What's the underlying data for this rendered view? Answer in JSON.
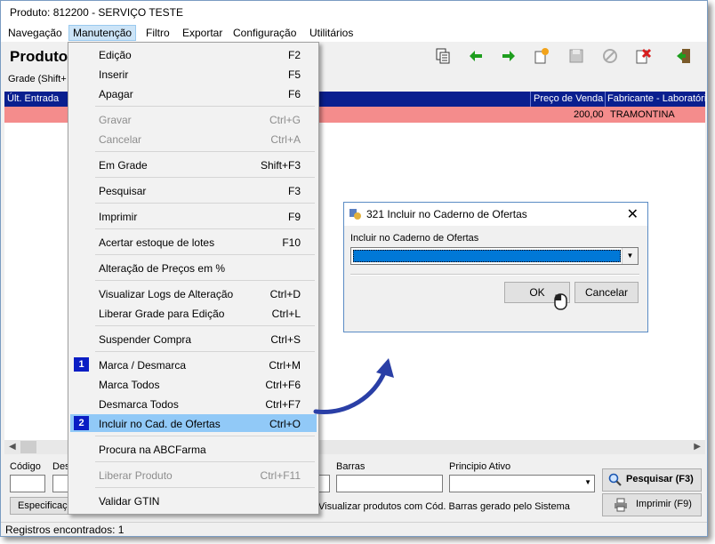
{
  "window": {
    "title": "Produto: 812200 - SERVIÇO TESTE"
  },
  "menubar": {
    "items": [
      "Navegação",
      "Manutenção",
      "Filtro",
      "Exportar",
      "Configuração",
      "Utilitários"
    ]
  },
  "page": {
    "title": "Produtos",
    "subbar": "Grade (Shift+"
  },
  "grid": {
    "columns": [
      "Últ. Entrada",
      "Preço de Venda",
      "Fabricante - Laboratório"
    ],
    "row": {
      "preco": "200,00",
      "fabricante": "TRAMONTINA"
    }
  },
  "menu": {
    "items": [
      {
        "label": "Edição",
        "shortcut": "F2"
      },
      {
        "label": "Inserir",
        "shortcut": "F5"
      },
      {
        "label": "Apagar",
        "shortcut": "F6"
      },
      {
        "label": "Gravar",
        "shortcut": "Ctrl+G"
      },
      {
        "label": "Cancelar",
        "shortcut": "Ctrl+A"
      },
      {
        "label": "Em Grade",
        "shortcut": "Shift+F3"
      },
      {
        "label": "Pesquisar",
        "shortcut": "F3"
      },
      {
        "label": "Imprimir",
        "shortcut": "F9"
      },
      {
        "label": "Acertar estoque de lotes",
        "shortcut": "F10"
      },
      {
        "label": "Alteração de Preços em %",
        "shortcut": ""
      },
      {
        "label": "Visualizar Logs de Alteração",
        "shortcut": "Ctrl+D"
      },
      {
        "label": "Liberar Grade para Edição",
        "shortcut": "Ctrl+L"
      },
      {
        "label": "Suspender Compra",
        "shortcut": "Ctrl+S"
      },
      {
        "label": "Marca / Desmarca",
        "shortcut": "Ctrl+M",
        "badge": "1"
      },
      {
        "label": "Marca Todos",
        "shortcut": "Ctrl+F6"
      },
      {
        "label": "Desmarca Todos",
        "shortcut": "Ctrl+F7"
      },
      {
        "label": "Incluir no Cad. de Ofertas",
        "shortcut": "Ctrl+O",
        "badge": "2"
      },
      {
        "label": "Procura na ABCFarma",
        "shortcut": ""
      },
      {
        "label": "Liberar Produto",
        "shortcut": "Ctrl+F11"
      },
      {
        "label": "Validar GTIN",
        "shortcut": ""
      }
    ]
  },
  "filters": {
    "codigo_label": "Código",
    "desc_label": "Des",
    "barras_label": "Barras",
    "principio_label": "Principio Ativo",
    "especificacao_tab": "Especificaç",
    "checkbox_label": "Visualizar produtos com Cód. Barras gerado pelo Sistema",
    "pesquisar_button": "Pesquisar (F3)",
    "imprimir_button": "Imprimir (F9)"
  },
  "status": {
    "text": "Registros encontrados: 1"
  },
  "dialog": {
    "title": "321 Incluir no Caderno de Ofertas",
    "label": "Incluir no Caderno de Ofertas",
    "ok": "OK",
    "cancel": "Cancelar"
  },
  "colors": {
    "grid_header": "#0a1f8f",
    "grid_row": "#f48c8c",
    "menu_highlight": "#91c9f7",
    "badge": "#0a1dc4",
    "arrow": "#2a3fa6"
  }
}
